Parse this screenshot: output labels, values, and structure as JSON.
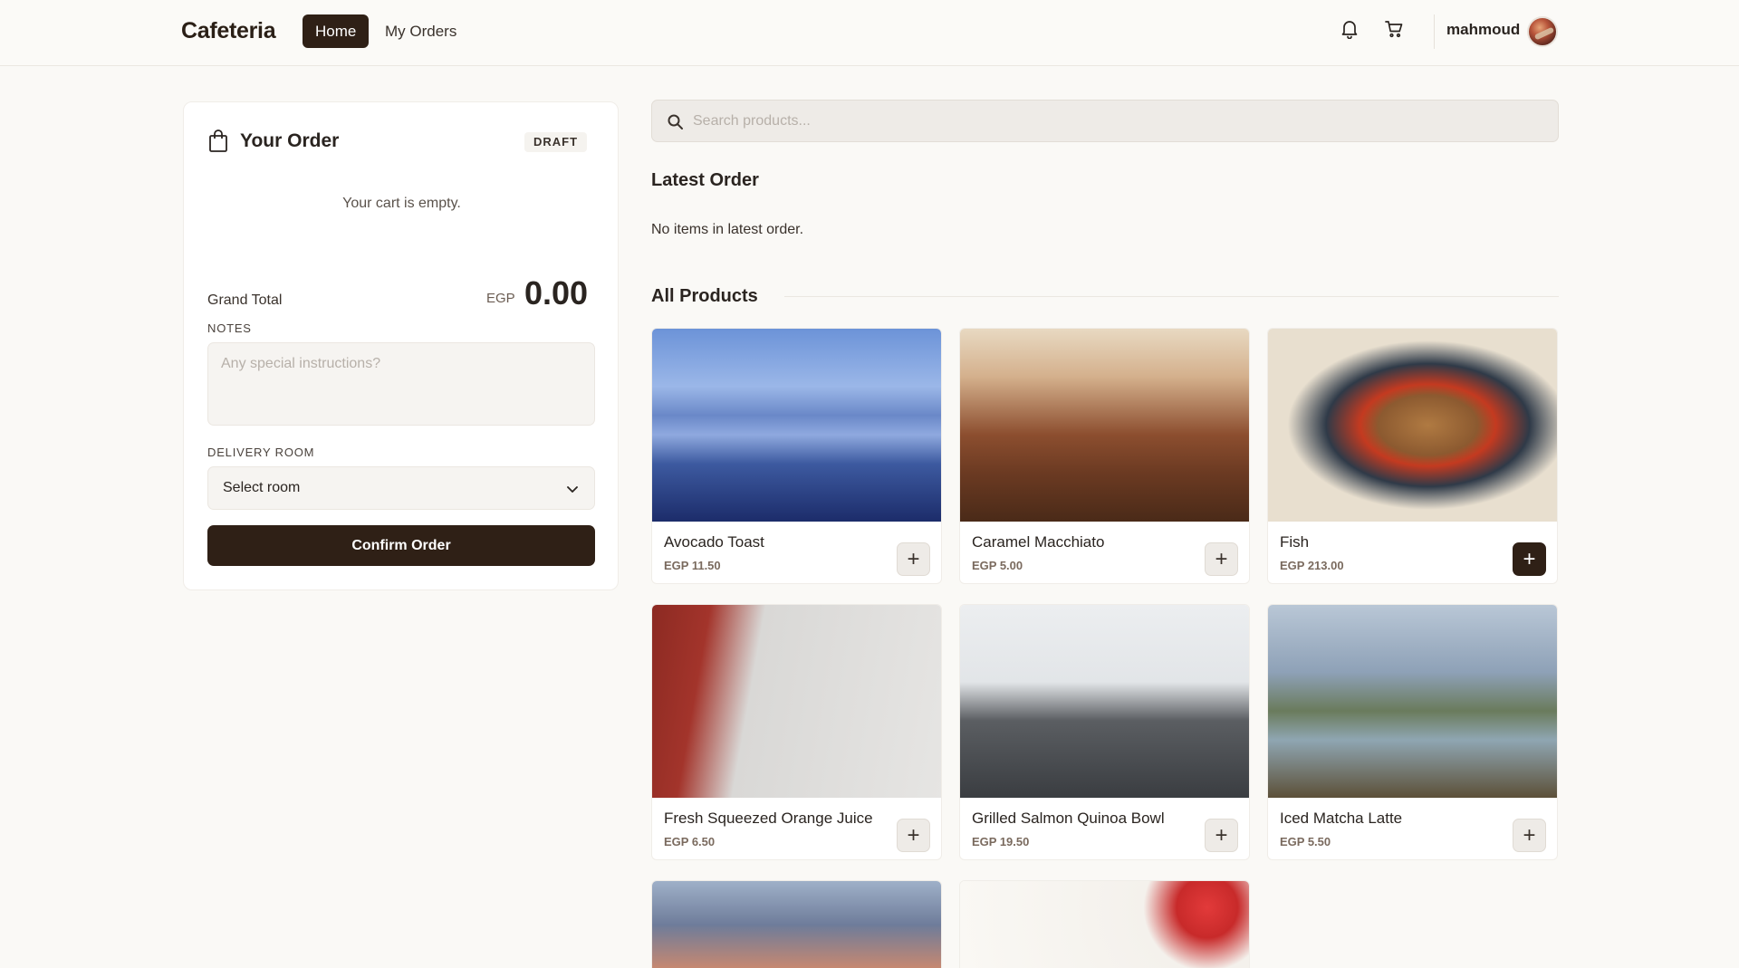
{
  "header": {
    "brand": "Cafeteria",
    "nav": {
      "home": "Home",
      "orders": "My Orders"
    },
    "username": "mahmoud",
    "icons": {
      "notifications": "bell-icon",
      "cart": "cart-icon"
    }
  },
  "order": {
    "title": "Your Order",
    "status": "DRAFT",
    "empty_message": "Your cart is empty.",
    "grand_total_label": "Grand Total",
    "currency": "EGP",
    "grand_total": "0.00",
    "notes_label": "NOTES",
    "notes_placeholder": "Any special instructions?",
    "room_label": "DELIVERY ROOM",
    "room_value": "Select room",
    "confirm_label": "Confirm Order"
  },
  "main": {
    "search_placeholder": "Search products...",
    "latest_title": "Latest Order",
    "latest_empty": "No items in latest order.",
    "all_title": "All Products"
  },
  "products": [
    {
      "name": "Avocado Toast",
      "price": "EGP 11.50",
      "add": "+"
    },
    {
      "name": "Caramel Macchiato",
      "price": "EGP 5.00",
      "add": "+"
    },
    {
      "name": "Fish",
      "price": "EGP 213.00",
      "add": "+"
    },
    {
      "name": "Fresh Squeezed Orange Juice",
      "price": "EGP 6.50",
      "add": "+"
    },
    {
      "name": "Grilled Salmon Quinoa Bowl",
      "price": "EGP 19.50",
      "add": "+"
    },
    {
      "name": "Iced Matcha Latte",
      "price": "EGP 5.50",
      "add": "+"
    }
  ],
  "colors": {
    "accent": "#2f2016",
    "background": "#faf9f6"
  }
}
